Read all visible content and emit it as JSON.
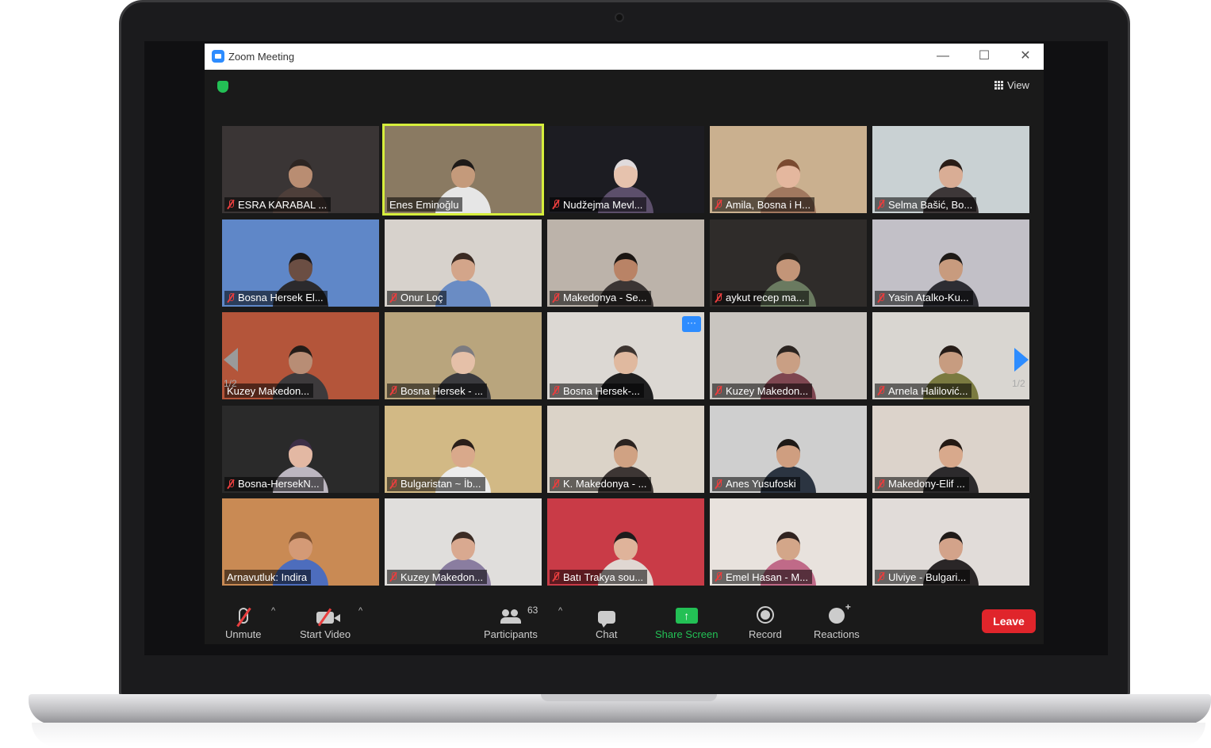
{
  "window": {
    "title": "Zoom Meeting",
    "min_glyph": "—",
    "max_glyph": "☐",
    "close_glyph": "✕",
    "view_label": "View"
  },
  "gallery": {
    "page_label_left": "1/2",
    "page_label_right": "1/2",
    "more_glyph": "···",
    "participants": [
      {
        "name": "ESRA KARABAL ...",
        "muted": true,
        "skin": "#b98d72",
        "hair": "#2d2522",
        "shirt": "#4e3f3a",
        "bg": "#3a3535"
      },
      {
        "name": "Enes Eminoğlu",
        "muted": false,
        "skin": "#c49a7b",
        "hair": "#1e1a18",
        "shirt": "#e6e6e6",
        "bg": "#8a7a62",
        "active": true
      },
      {
        "name": "Nudžejma Mevl...",
        "muted": true,
        "skin": "#e6c2ad",
        "hair": "#e0dbdc",
        "shirt": "#5c4f6b",
        "bg": "#1c1c22"
      },
      {
        "name": "Amila, Bosna i H...",
        "muted": true,
        "skin": "#e4b79e",
        "hair": "#7a4a30",
        "shirt": "#a1785f",
        "bg": "#cab08f"
      },
      {
        "name": "Selma Bašić, Bo...",
        "muted": true,
        "skin": "#d9ad95",
        "hair": "#2a1d17",
        "shirt": "#3d3738",
        "bg": "#c9d1d3"
      },
      {
        "name": "Bosna Hersek El...",
        "muted": true,
        "skin": "#6b4e43",
        "hair": "#1a1717",
        "shirt": "#2b2a2d",
        "bg": "#5f87c8"
      },
      {
        "name": "Onur Loç",
        "muted": true,
        "skin": "#d3a58a",
        "hair": "#3a2a22",
        "shirt": "#6a8cc4",
        "bg": "#d7d2cc"
      },
      {
        "name": "Makedonya - Se...",
        "muted": true,
        "skin": "#b98366",
        "hair": "#1a1512",
        "shirt": "#3b3534",
        "bg": "#bcb3aa"
      },
      {
        "name": "aykut recep ma...",
        "muted": true,
        "skin": "#c39578",
        "hair": "#24201c",
        "shirt": "#6a7a60",
        "bg": "#2f2c2a"
      },
      {
        "name": "Yasin Atalko-Ku...",
        "muted": true,
        "skin": "#c89b7e",
        "hair": "#1e1a17",
        "shirt": "#2d2d33",
        "bg": "#c2c0c7"
      },
      {
        "name": "Kuzey Makedon...",
        "muted": false,
        "skin": "#b88d75",
        "hair": "#241c18",
        "shirt": "#3d3a3c",
        "bg": "#b4553a"
      },
      {
        "name": "Bosna Hersek - ...",
        "muted": true,
        "skin": "#e5c0a8",
        "hair": "#7c7b80",
        "shirt": "#3a3a3e",
        "bg": "#b9a57d"
      },
      {
        "name": "Bosna Hersek-...",
        "muted": true,
        "skin": "#e0b99f",
        "hair": "#3d3430",
        "shirt": "#1e1e1f",
        "bg": "#dcd8d3"
      },
      {
        "name": "Kuzey Makedon...",
        "muted": true,
        "skin": "#c99f84",
        "hair": "#2b2420",
        "shirt": "#7e4650",
        "bg": "#c9c5c0"
      },
      {
        "name": "Arnela Halilović...",
        "muted": true,
        "skin": "#c79c80",
        "hair": "#261c17",
        "shirt": "#7a7a40",
        "bg": "#d9d6d1"
      },
      {
        "name": "Bosna-HersekN...",
        "muted": true,
        "skin": "#e3b8a3",
        "hair": "#3d2f47",
        "shirt": "#bcb6c0",
        "bg": "#2a2a2a"
      },
      {
        "name": "Bulgaristan ~ İb...",
        "muted": true,
        "skin": "#d9a98b",
        "hair": "#2a1f1a",
        "shirt": "#ececec",
        "bg": "#d2b985"
      },
      {
        "name": "K. Makedonya - ...",
        "muted": true,
        "skin": "#d0a283",
        "hair": "#2b2320",
        "shirt": "#3d3634",
        "bg": "#dbd3c8"
      },
      {
        "name": "Anes Yusufoski",
        "muted": true,
        "skin": "#cf9e80",
        "hair": "#1e1916",
        "shirt": "#2b3441",
        "bg": "#cfcfcf"
      },
      {
        "name": "Makedony-Elif ...",
        "muted": true,
        "skin": "#d8a98c",
        "hair": "#241913",
        "shirt": "#2c2a2c",
        "bg": "#dcd3cb"
      },
      {
        "name": "Arnavutluk: Indira",
        "muted": false,
        "skin": "#d49a76",
        "hair": "#7a4f2f",
        "shirt": "#4d6dbd",
        "bg": "#c98a54"
      },
      {
        "name": "Kuzey Makedon...",
        "muted": true,
        "skin": "#d9a990",
        "hair": "#3b2b24",
        "shirt": "#8a7da0",
        "bg": "#e0dedc"
      },
      {
        "name": "Batı Trakya sou...",
        "muted": true,
        "skin": "#dfb39a",
        "hair": "#1e1b1c",
        "shirt": "#e0d7d2",
        "bg": "#c93b47"
      },
      {
        "name": "Emel Hasan - M...",
        "muted": true,
        "skin": "#d3a689",
        "hair": "#302320",
        "shirt": "#c06a88",
        "bg": "#e8e2dd"
      },
      {
        "name": "Ulviye - Bulgari...",
        "muted": true,
        "skin": "#d3a38a",
        "hair": "#1f1a18",
        "shirt": "#2a2627",
        "bg": "#e1dcd9"
      }
    ]
  },
  "toolbar": {
    "unmute": "Unmute",
    "start_video": "Start Video",
    "participants": "Participants",
    "participant_count": "63",
    "chat": "Chat",
    "share_screen": "Share Screen",
    "record": "Record",
    "reactions": "Reactions",
    "leave": "Leave",
    "caret_glyph": "^",
    "share_glyph": "↑"
  },
  "colors": {
    "accent": "#2d8cff",
    "active_speaker": "#d6ee3c",
    "leave": "#e0252b",
    "share": "#23c055",
    "muted": "#e83e3e"
  }
}
